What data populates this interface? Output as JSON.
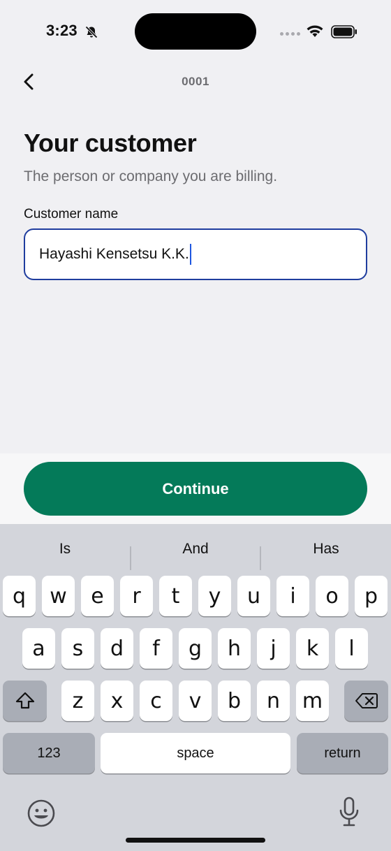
{
  "status": {
    "time": "3:23",
    "icons": [
      "bell-slash-icon",
      "signal-icon",
      "wifi-icon",
      "battery-icon"
    ]
  },
  "nav": {
    "back_icon": "chevron-left-icon",
    "title": "0001"
  },
  "form": {
    "title": "Your customer",
    "subtitle": "The person or company you are billing.",
    "customer_label": "Customer name",
    "customer_value": "Hayashi Kensetsu K.K."
  },
  "actions": {
    "continue_label": "Continue"
  },
  "keyboard": {
    "suggestions": [
      "Is",
      "And",
      "Has"
    ],
    "row1": [
      "q",
      "w",
      "e",
      "r",
      "t",
      "y",
      "u",
      "i",
      "o",
      "p"
    ],
    "row2": [
      "a",
      "s",
      "d",
      "f",
      "g",
      "h",
      "j",
      "k",
      "l"
    ],
    "row3": [
      "z",
      "x",
      "c",
      "v",
      "b",
      "n",
      "m"
    ],
    "numbers_label": "123",
    "space_label": "space",
    "return_label": "return",
    "shift_icon": "shift-icon",
    "delete_icon": "delete-icon",
    "emoji_icon": "emoji-icon",
    "mic_icon": "microphone-icon"
  },
  "colors": {
    "accent": "#047a59",
    "input_border": "#1f3d9e",
    "background": "#f0f0f3",
    "keyboard_bg": "#d3d5db"
  }
}
